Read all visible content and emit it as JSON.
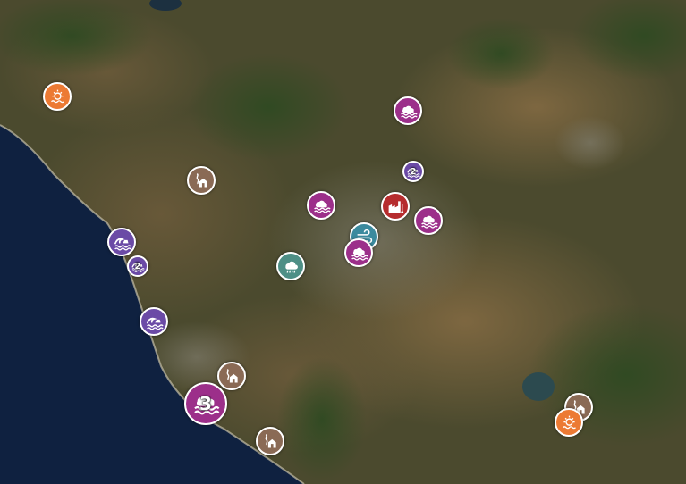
{
  "colors": {
    "flood": "#9c2f8a",
    "storm_surge": "#6b4aa6",
    "landslide": "#8a6a55",
    "heat": "#ec7a34",
    "rain": "#4e8f86",
    "industrial": "#b62c2e",
    "wind": "#3b8a9e",
    "sea": "#0f2140"
  },
  "markers": [
    {
      "type": "heat",
      "icon": "heat-wave-icon"
    },
    {
      "type": "flood",
      "icon": "flood-icon"
    },
    {
      "type": "storm_surge",
      "icon": "storm-surge-icon",
      "count": "2"
    },
    {
      "type": "landslide",
      "icon": "landslide-icon"
    },
    {
      "type": "flood",
      "icon": "flood-icon"
    },
    {
      "type": "industrial",
      "icon": "industrial-accident-icon"
    },
    {
      "type": "flood",
      "icon": "flood-icon"
    },
    {
      "type": "storm_surge",
      "icon": "storm-surge-icon"
    },
    {
      "type": "wind",
      "icon": "strong-wind-icon"
    },
    {
      "type": "flood",
      "icon": "flood-icon"
    },
    {
      "type": "storm_surge",
      "icon": "storm-surge-icon",
      "count": "2"
    },
    {
      "type": "rain",
      "icon": "heavy-rain-icon"
    },
    {
      "type": "storm_surge",
      "icon": "storm-surge-icon"
    },
    {
      "type": "landslide",
      "icon": "landslide-icon"
    },
    {
      "type": "flood",
      "icon": "flood-icon",
      "count": "3"
    },
    {
      "type": "landslide",
      "icon": "landslide-icon"
    },
    {
      "type": "landslide",
      "icon": "landslide-icon"
    },
    {
      "type": "heat",
      "icon": "heat-wave-icon"
    }
  ]
}
